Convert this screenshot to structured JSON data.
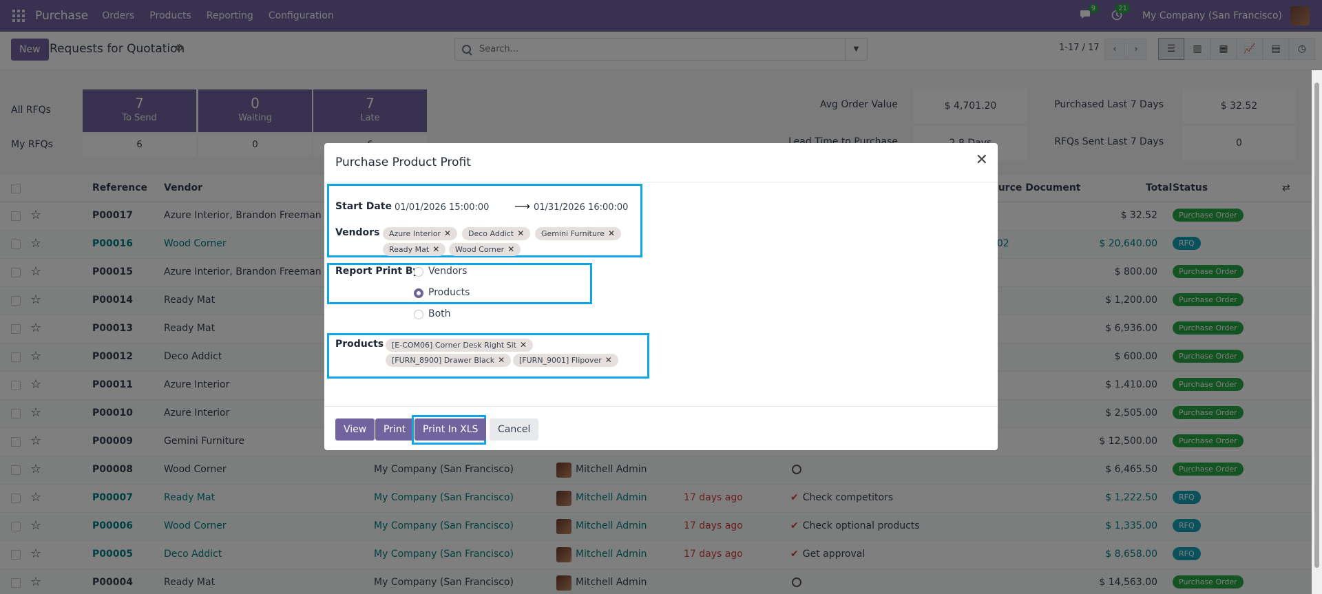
{
  "navbar": {
    "app_name": "Purchase",
    "menu": [
      "Orders",
      "Products",
      "Reporting",
      "Configuration"
    ],
    "messages_badge": "9",
    "activity_badge": "21",
    "company": "My Company (San Francisco)"
  },
  "control": {
    "new_label": "New",
    "title": "Requests for Quotation",
    "search_placeholder": "Search...",
    "pager": "1-17 / 17"
  },
  "dashboard": {
    "all_rfqs": "All RFQs",
    "my_rfqs": "My RFQs",
    "tiles": [
      {
        "num": "7",
        "label": "To Send",
        "mine": "6"
      },
      {
        "num": "0",
        "label": "Waiting",
        "mine": "0"
      },
      {
        "num": "7",
        "label": "Late",
        "mine": "6"
      }
    ],
    "kpis": {
      "avg_order_label": "Avg Order Value",
      "avg_order_value": "$ 4,701.20",
      "purchased_label": "Purchased Last 7 Days",
      "purchased_value": "$ 32.52",
      "lead_time_label": "Lead Time to Purchase",
      "lead_time_value": "2.8 Days",
      "rfqs_sent_label": "RFQs Sent Last 7 Days",
      "rfqs_sent_value": "0"
    }
  },
  "table": {
    "headers": {
      "reference": "Reference",
      "vendor": "Vendor",
      "source_document": "Source Document",
      "total": "Total",
      "status": "Status"
    },
    "rows": [
      {
        "ref": "P00017",
        "vendor": "Azure Interior, Brandon Freeman",
        "company": "",
        "buyer": "",
        "deadline": "",
        "activity": "",
        "source": "",
        "total": "$ 32.52",
        "status": "Purchase Order"
      },
      {
        "ref": "P00016",
        "vendor": "Wood Corner",
        "company": "",
        "buyer": "",
        "deadline": "",
        "activity": "",
        "source": "0002",
        "total": "$ 20,640.00",
        "status": "RFQ"
      },
      {
        "ref": "P00015",
        "vendor": "Azure Interior, Brandon Freeman",
        "company": "",
        "buyer": "",
        "deadline": "",
        "activity": "",
        "source": "",
        "total": "$ 800.00",
        "status": "Purchase Order"
      },
      {
        "ref": "P00014",
        "vendor": "Ready Mat",
        "company": "",
        "buyer": "",
        "deadline": "",
        "activity": "",
        "source": "",
        "total": "$ 1,200.00",
        "status": "Purchase Order"
      },
      {
        "ref": "P00013",
        "vendor": "Ready Mat",
        "company": "",
        "buyer": "",
        "deadline": "",
        "activity": "",
        "source": "",
        "total": "$ 6,936.00",
        "status": "Purchase Order"
      },
      {
        "ref": "P00012",
        "vendor": "Deco Addict",
        "company": "",
        "buyer": "",
        "deadline": "",
        "activity": "",
        "source": "",
        "total": "$ 600.00",
        "status": "Purchase Order"
      },
      {
        "ref": "P00011",
        "vendor": "Azure Interior",
        "company": "",
        "buyer": "",
        "deadline": "",
        "activity": "",
        "source": "",
        "total": "$ 1,410.00",
        "status": "Purchase Order"
      },
      {
        "ref": "P00010",
        "vendor": "Azure Interior",
        "company": "",
        "buyer": "",
        "deadline": "",
        "activity": "",
        "source": "",
        "total": "$ 2,505.00",
        "status": "Purchase Order"
      },
      {
        "ref": "P00009",
        "vendor": "Gemini Furniture",
        "company": "",
        "buyer": "",
        "deadline": "",
        "activity": "",
        "source": "",
        "total": "$ 12,500.00",
        "status": "Purchase Order"
      },
      {
        "ref": "P00008",
        "vendor": "Wood Corner",
        "company": "My Company (San Francisco)",
        "buyer": "Mitchell Admin",
        "deadline": "",
        "activity": "",
        "source": "",
        "total": "$ 6,465.50",
        "status": "Purchase Order"
      },
      {
        "ref": "P00007",
        "vendor": "Ready Mat",
        "company": "My Company (San Francisco)",
        "buyer": "Mitchell Admin",
        "deadline": "17 days ago",
        "activity": "Check competitors",
        "source": "",
        "total": "$ 1,222.50",
        "status": "RFQ"
      },
      {
        "ref": "P00006",
        "vendor": "Wood Corner",
        "company": "My Company (San Francisco)",
        "buyer": "Mitchell Admin",
        "deadline": "17 days ago",
        "activity": "Check optional products",
        "source": "",
        "total": "$ 1,335.00",
        "status": "RFQ"
      },
      {
        "ref": "P00005",
        "vendor": "Deco Addict",
        "company": "My Company (San Francisco)",
        "buyer": "Mitchell Admin",
        "deadline": "17 days ago",
        "activity": "Get approval",
        "source": "",
        "total": "$ 8,658.00",
        "status": "RFQ"
      },
      {
        "ref": "P00004",
        "vendor": "Ready Mat",
        "company": "My Company (San Francisco)",
        "buyer": "Mitchell Admin",
        "deadline": "",
        "activity": "",
        "source": "",
        "total": "$ 14,563.00",
        "status": "Purchase Order"
      }
    ]
  },
  "modal": {
    "title": "Purchase Product Profit",
    "start_date_label": "Start Date",
    "start_date": "01/01/2026 15:00:00",
    "end_date": "01/31/2026 16:00:00",
    "vendors_label": "Vendors",
    "vendors": [
      "Azure Interior",
      "Deco Addict",
      "Gemini Furniture",
      "Ready Mat",
      "Wood Corner"
    ],
    "report_print_by_label": "Report Print By",
    "options": [
      "Vendors",
      "Products",
      "Both"
    ],
    "selected_option": "Products",
    "products_label": "Products",
    "products": [
      "[E-COM06] Corner Desk Right Sit",
      "[FURN_8900] Drawer Black",
      "[FURN_9001] Flipover"
    ],
    "buttons": {
      "view": "View",
      "print": "Print",
      "print_xls": "Print In XLS",
      "cancel": "Cancel"
    }
  },
  "colors": {
    "brand": "#71639e",
    "highlight": "#0ea5e9",
    "po_badge": "#28a745",
    "rfq_badge": "#17a2b8"
  }
}
